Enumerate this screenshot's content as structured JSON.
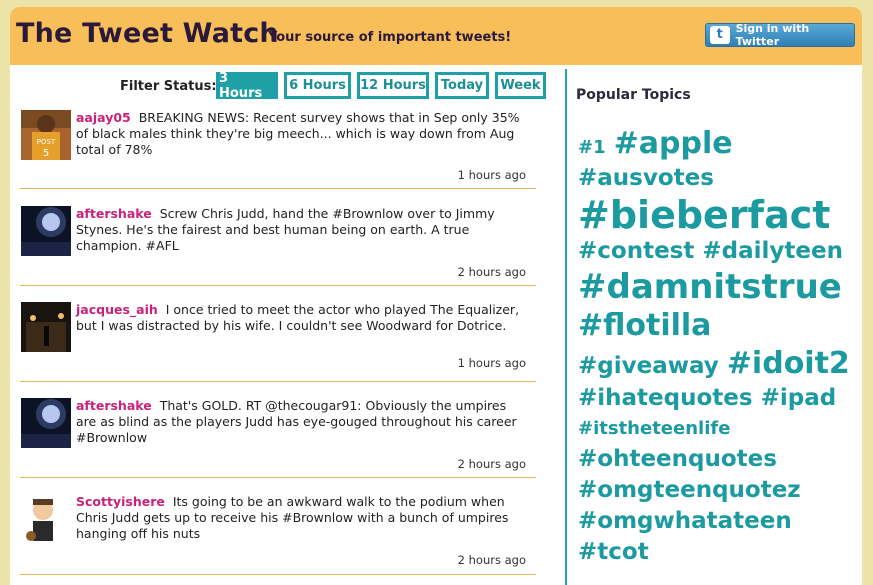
{
  "header": {
    "title": "The Tweet Watch",
    "tagline": "Your source of important tweets!",
    "signin_label": "Sign in with Twitter",
    "signin_icon": "twitter-bird-icon"
  },
  "filter": {
    "label": "Filter Status:",
    "options": [
      "3 Hours",
      "6 Hours",
      "12 Hours",
      "Today",
      "Week"
    ],
    "selected": "3 Hours"
  },
  "tweets": [
    {
      "user": "aajay05",
      "text": "BREAKING NEWS: Recent survey shows that in Sep only 35% of black males think they're big meech... which is way down from Aug total of 78%",
      "time": "1 hours ago"
    },
    {
      "user": "aftershake",
      "text": "Screw Chris Judd, hand the #Brownlow over to Jimmy Stynes. He's the fairest and best human being on earth. A true champion. #AFL",
      "time": "2 hours ago"
    },
    {
      "user": "jacques_aih",
      "text": "I once tried to meet the actor who played The Equalizer, but I was distracted by his wife. I couldn't see Woodward for Dotrice.",
      "time": "1 hours ago"
    },
    {
      "user": "aftershake",
      "text": "That's GOLD. RT @thecougar91: Obviously the umpires are as blind as the players Judd has eye-gouged throughout his career #Brownlow",
      "time": "2 hours ago"
    },
    {
      "user": "Scottyishere",
      "text": "Its going to be an awkward walk to the podium when Chris Judd gets up to receive his #Brownlow with a bunch of umpires hanging off his nuts",
      "time": "2 hours ago"
    }
  ],
  "popular": {
    "title": "Popular Topics",
    "topics": [
      {
        "tag": "#1",
        "weight": 1
      },
      {
        "tag": "#apple",
        "weight": 3
      },
      {
        "tag": "#ausvotes",
        "weight": 2
      },
      {
        "tag": "#bieberfact",
        "weight": 5
      },
      {
        "tag": "#contest",
        "weight": 2
      },
      {
        "tag": "#dailyteen",
        "weight": 2
      },
      {
        "tag": "#damnitstrue",
        "weight": 4
      },
      {
        "tag": "#flotilla",
        "weight": 3
      },
      {
        "tag": "#giveaway",
        "weight": 2
      },
      {
        "tag": "#idoit2",
        "weight": 3
      },
      {
        "tag": "#ihatequotes",
        "weight": 2
      },
      {
        "tag": "#ipad",
        "weight": 2
      },
      {
        "tag": "#itstheteenlife",
        "weight": 1
      },
      {
        "tag": "#ohteenquotes",
        "weight": 2
      },
      {
        "tag": "#omgteenquotez",
        "weight": 2
      },
      {
        "tag": "#omgwhatateen",
        "weight": 2
      },
      {
        "tag": "#tcot",
        "weight": 2
      }
    ]
  },
  "colors": {
    "header_bg": "#f7be5a",
    "accent": "#1fa0a6",
    "username": "#c8227a",
    "page_bg": "#ebe3a8"
  }
}
